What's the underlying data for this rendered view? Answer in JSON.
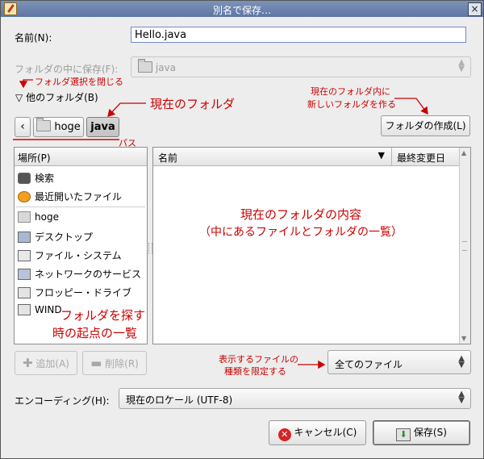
{
  "window": {
    "title": "別名で保存…"
  },
  "name_label": "名前(N):",
  "name_value": "Hello.java",
  "save_in_label": "フォルダの中に保存(F):",
  "save_in_value": "java",
  "other_folders_label": "他のフォルダ(B)",
  "path": {
    "back": "‹",
    "items": [
      "hoge",
      "java"
    ]
  },
  "create_folder_label": "フォルダの作成(L)",
  "places": {
    "header": "場所(P)",
    "items": [
      "検索",
      "最近開いたファイル",
      "hoge",
      "デスクトップ",
      "ファイル・システム",
      "ネットワークのサービス",
      "フロッピー・ドライブ",
      "WIND"
    ]
  },
  "files": {
    "col_name": "名前",
    "col_modified": "最終変更日"
  },
  "add_label": "追加(A)",
  "remove_label": "削除(R)",
  "filter_value": "全てのファイル",
  "encoding_label": "エンコーディング(H):",
  "encoding_value": "現在のロケール (UTF-8)",
  "cancel_label": "キャンセル(C)",
  "save_label": "保存(S)",
  "annotations": {
    "close_folder_select": "フォルダ選択を閉じる",
    "current_folder": "現在のフォルダ",
    "new_folder_1": "現在のフォルダ内に",
    "new_folder_2": "新しいフォルダを作る",
    "path": "パス",
    "contents_1": "現在のフォルダの内容",
    "contents_2": "（中にあるファイルとフォルダの一覧）",
    "start_points_1": "フォルダを探す",
    "start_points_2": "時の起点の一覧",
    "filter_1": "表示するファイルの",
    "filter_2": "種類を限定する"
  },
  "colors": {
    "annotation": "#cc0000",
    "titlebar": "#6b82ad"
  }
}
